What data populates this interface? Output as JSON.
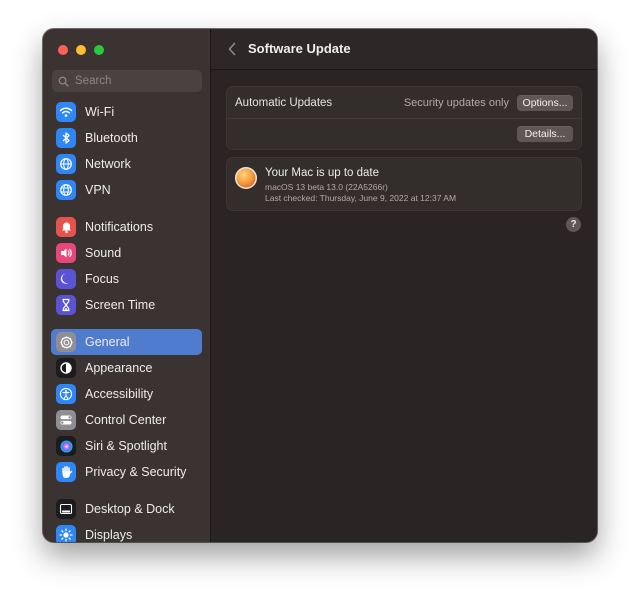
{
  "search": {
    "placeholder": "Search"
  },
  "sidebar": {
    "items": [
      {
        "label": "Wi-Fi",
        "icon": "wifi-icon",
        "color": "#2f86f6"
      },
      {
        "label": "Bluetooth",
        "icon": "bluetooth-icon",
        "color": "#2f86f6"
      },
      {
        "label": "Network",
        "icon": "globe-icon",
        "color": "#2f86f6"
      },
      {
        "label": "VPN",
        "icon": "vpn-globe-icon",
        "color": "#2f86f6"
      },
      {
        "label": "Notifications",
        "icon": "bell-icon",
        "color": "#e6534d"
      },
      {
        "label": "Sound",
        "icon": "speaker-icon",
        "color": "#e6467a"
      },
      {
        "label": "Focus",
        "icon": "moon-icon",
        "color": "#5b53d6"
      },
      {
        "label": "Screen Time",
        "icon": "hourglass-icon",
        "color": "#5b53d6"
      },
      {
        "label": "General",
        "icon": "gear-icon",
        "color": "#8e8e93",
        "selected": true
      },
      {
        "label": "Appearance",
        "icon": "appearance-icon",
        "color": "#1c1c1e"
      },
      {
        "label": "Accessibility",
        "icon": "accessibility-icon",
        "color": "#2f86f6"
      },
      {
        "label": "Control Center",
        "icon": "toggles-icon",
        "color": "#8e8e93"
      },
      {
        "label": "Siri & Spotlight",
        "icon": "siri-icon",
        "color": "#1c1c1e"
      },
      {
        "label": "Privacy & Security",
        "icon": "hand-icon",
        "color": "#2f86f6"
      },
      {
        "label": "Desktop & Dock",
        "icon": "dock-icon",
        "color": "#1c1c1e"
      },
      {
        "label": "Displays",
        "icon": "sun-icon",
        "color": "#2f86f6"
      }
    ]
  },
  "main": {
    "title": "Software Update",
    "auto_updates": {
      "label": "Automatic Updates",
      "value": "Security updates only",
      "options_button": "Options...",
      "details_button": "Details..."
    },
    "status": {
      "title": "Your Mac is up to date",
      "version": "macOS 13 beta 13.0 (22A5266r)",
      "last_checked": "Last checked: Thursday, June 9, 2022 at 12:37 AM"
    },
    "help_label": "?"
  }
}
